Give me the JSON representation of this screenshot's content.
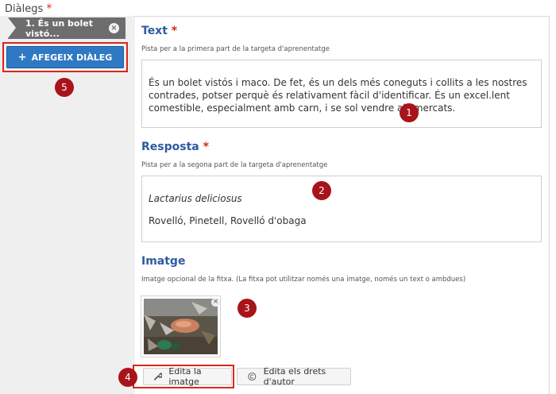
{
  "header": {
    "label": "Diàlegs",
    "required_mark": "*"
  },
  "sidebar": {
    "dialog_tab_label": "1. És un bolet vistó...",
    "tab_close_glyph": "×",
    "add_button": {
      "icon": "+",
      "label": "AFEGEIX DIÀLEG"
    }
  },
  "fields": {
    "text": {
      "title": "Text",
      "required_mark": "*",
      "hint": "Pista per a la primera part de la targeta d'aprenentatge",
      "value": "És un bolet vistós i maco. De fet, és un dels més coneguts i collits a les nostres contrades, potser perquè és relativament fàcil d'identificar. És un excel.lent comestible, especialment amb carn, i se sol vendre als mercats."
    },
    "answer": {
      "title": "Resposta",
      "required_mark": "*",
      "hint": "Pista per a la segona part de la targeta d'aprenentatge",
      "line1": "Lactarius deliciosus",
      "line2": "Rovelló, Pinetell, Rovelló d'obaga"
    },
    "image": {
      "title": "Imatge",
      "hint": "Imatge opcional de la fitxa. (La fitxa pot utilitzar només una imatge, només un text o ambdues)",
      "close_glyph": "×"
    }
  },
  "buttons": {
    "edit_image": "Edita la imatge",
    "edit_copyright": "Edita els drets d'autor"
  },
  "annotations": [
    "1",
    "2",
    "3",
    "4",
    "5"
  ],
  "colors": {
    "accent": "#2f78c4",
    "title_blue": "#2f5aa0",
    "badge": "#a8141a",
    "highlight": "#d9261c"
  }
}
